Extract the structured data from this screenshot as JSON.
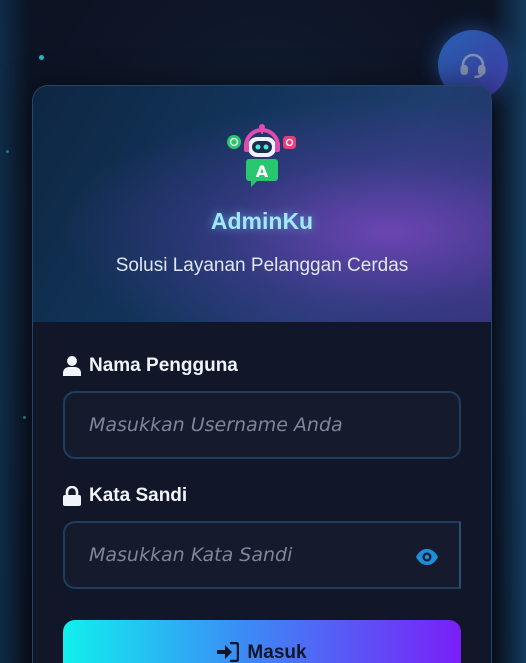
{
  "app": {
    "title": "AdminKu",
    "subtitle": "Solusi Layanan Pelanggan Cerdas"
  },
  "form": {
    "username": {
      "label": "Nama Pengguna",
      "placeholder": "Masukkan Username Anda",
      "icon": "user-icon"
    },
    "password": {
      "label": "Kata Sandi",
      "placeholder": "Masukkan Kata Sandi",
      "icon": "lock-icon",
      "toggle_icon": "eye-icon"
    },
    "submit_label": "Masuk",
    "submit_icon": "sign-in-icon"
  },
  "support": {
    "icon": "headset-icon"
  },
  "colors": {
    "accent_cyan": "#10f0ee",
    "accent_blue": "#3b8cf6",
    "accent_purple": "#7a1ff7",
    "title_glow": "#9fe9ff",
    "background": "#0d1526"
  }
}
